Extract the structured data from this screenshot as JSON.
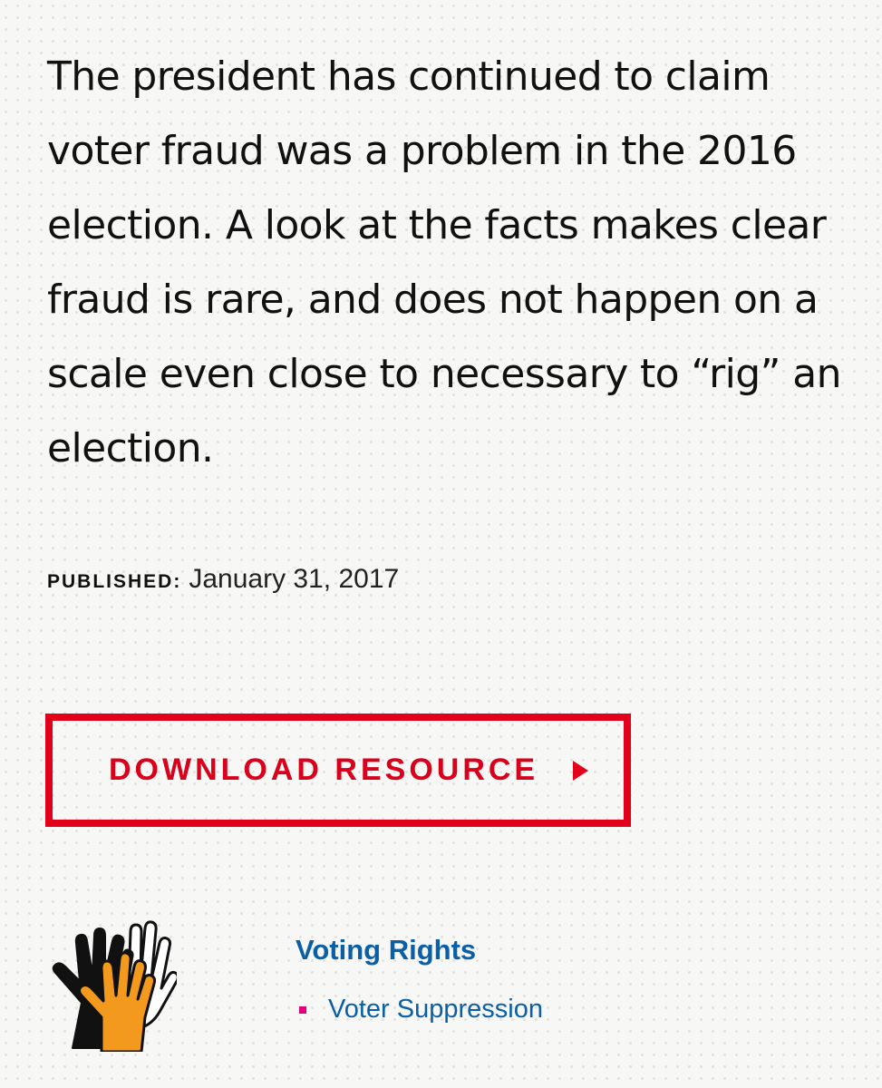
{
  "article": {
    "summary": "The president has continued to claim voter fraud was a problem in the 2016 election. A look at the facts makes clear fraud is rare, and does not happen on a scale even close to necessary to “rig” an election."
  },
  "published": {
    "label": "Published:",
    "date": "January 31, 2017"
  },
  "download": {
    "label": "DOWNLOAD RESOURCE",
    "arrow_icon": "play-triangle-icon"
  },
  "topics": {
    "icon": "raised-hands-icon",
    "heading": "Voting Rights",
    "items": [
      {
        "label": "Voter Suppression"
      }
    ]
  },
  "colors": {
    "accent_red": "#e2001a",
    "link_blue": "#0b5fa5",
    "bullet_magenta": "#e4007c",
    "hand_orange": "#f39a1e"
  }
}
